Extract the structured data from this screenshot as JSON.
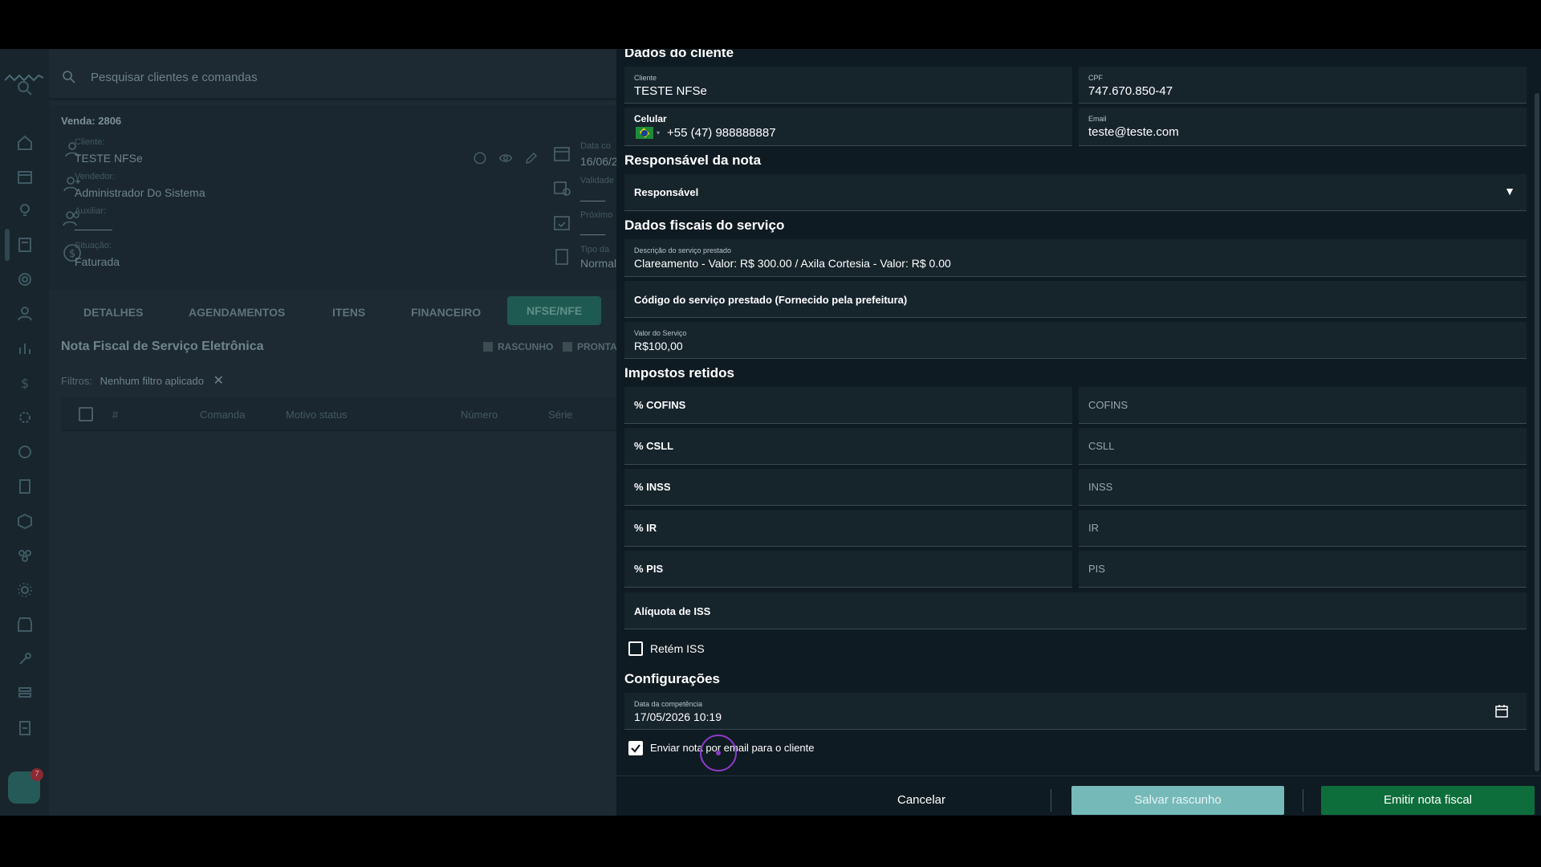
{
  "search": {
    "placeholder": "Pesquisar clientes e comandas"
  },
  "sale": {
    "title": "Venda: 2806",
    "cliente_label": "Cliente:",
    "cliente_value": "TESTE NFSe",
    "vendedor_label": "Vendedor:",
    "vendedor_value": "Administrador Do Sistema",
    "auxiliar_label": "Auxiliar:",
    "auxiliar_value": "______",
    "situacao_label": "Situação:",
    "situacao_value": "Faturada",
    "data_label": "Data co",
    "data_value": "16/06/2",
    "validade_label": "Validade",
    "validade_value": "____",
    "proximo_label": "Próximo",
    "proximo_value": "____",
    "tipo_label": "Tipo da",
    "tipo_value": "Normal"
  },
  "tabs": [
    "DETALHES",
    "AGENDAMENTOS",
    "ITENS",
    "FINANCEIRO",
    "NFSE/NFE"
  ],
  "list": {
    "title": "Nota Fiscal de Serviço Eletrônica",
    "legend_draft": "RASCUNHO",
    "legend_ready": "PRONTA",
    "filters_label": "Filtros:",
    "filters_value": "Nenhum filtro aplicado",
    "columns": [
      "#",
      "Comanda",
      "Motivo status",
      "Número",
      "Série"
    ]
  },
  "rail": {
    "badge": "7"
  },
  "panel": {
    "client_section": "Dados do cliente",
    "client_label": "Cliente",
    "client_value": "TESTE NFSe",
    "cpf_label": "CPF",
    "cpf_value": "747.670.850-47",
    "phone_label": "Celular",
    "phone_value": "+55 (47) 988888887",
    "email_label": "Email",
    "email_value": "teste@teste.com",
    "responsible_section": "Responsável da nota",
    "responsible_value": "Responsável",
    "fiscal_section": "Dados fiscais do serviço",
    "desc_label": "Descrição do serviço prestado",
    "desc_value": "Clareamento - Valor: R$ 300.00 / Axila Cortesia - Valor: R$ 0.00",
    "code_placeholder": "Código do serviço prestado (Fornecido pela prefeitura)",
    "service_value_label": "Valor do Serviço",
    "service_value": "R$100,00",
    "taxes_section": "Impostos retidos",
    "taxes": [
      {
        "pct": "% COFINS",
        "val": "COFINS"
      },
      {
        "pct": "% CSLL",
        "val": "CSLL"
      },
      {
        "pct": "% INSS",
        "val": "INSS"
      },
      {
        "pct": "% IR",
        "val": "IR"
      },
      {
        "pct": "% PIS",
        "val": "PIS"
      }
    ],
    "iss_rate": "Alíquota de ISS",
    "retain_iss": "Retém ISS",
    "config_section": "Configurações",
    "competencia_label": "Data da competência",
    "competencia_value": "17/05/2026 10:19",
    "send_email": "Enviar nota por email para o cliente"
  },
  "footer": {
    "cancel": "Cancelar",
    "save_draft": "Salvar rascunho",
    "emit": "Emitir nota fiscal"
  },
  "colors": {
    "emit": "#0e6e3b",
    "draft": "#76b9b9",
    "panel": "#0f1b22"
  }
}
